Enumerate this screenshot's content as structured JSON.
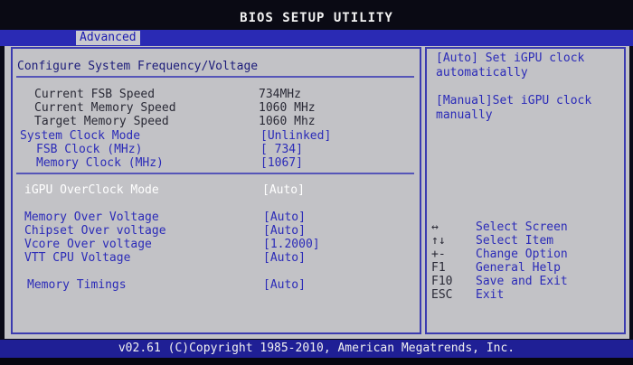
{
  "window": {
    "title": "BIOS SETUP UTILITY"
  },
  "tabs": [
    {
      "label": "Advanced",
      "active": true
    }
  ],
  "main": {
    "section_title": "Configure System Frequency/Voltage",
    "info_rows": [
      {
        "label": "Current FSB Speed",
        "value": "734MHz"
      },
      {
        "label": "Current Memory Speed",
        "value": "1060 MHz"
      },
      {
        "label": "Target Memory Speed",
        "value": "1060 Mhz"
      }
    ],
    "system_clock": [
      {
        "label": "System Clock Mode",
        "value": "[Unlinked]"
      },
      {
        "label": "FSB Clock (MHz)",
        "value": "[ 734]"
      },
      {
        "label": "Memory Clock (MHz)",
        "value": "[1067]"
      }
    ],
    "igpu": {
      "label": "iGPU OverClock Mode",
      "value": "[Auto]"
    },
    "voltages": [
      {
        "label": "Memory Over Voltage",
        "value": "[Auto]"
      },
      {
        "label": "Chipset Over voltage",
        "value": "[Auto]"
      },
      {
        "label": "Vcore Over voltage",
        "value": "[1.2000]"
      },
      {
        "label": "VTT CPU Voltage",
        "value": "[Auto]"
      }
    ],
    "timings": {
      "label": "Memory Timings",
      "value": "[Auto]"
    }
  },
  "help": {
    "auto_line1": "[Auto] Set iGPU clock",
    "auto_line2": "automatically",
    "manual_line1": "[Manual]Set iGPU clock",
    "manual_line2": "manually"
  },
  "keys": [
    {
      "key": "↔",
      "desc": "Select Screen"
    },
    {
      "key": "↑↓",
      "desc": "Select Item"
    },
    {
      "key": "+-",
      "desc": "Change Option"
    },
    {
      "key": "F1",
      "desc": "General Help"
    },
    {
      "key": "F10",
      "desc": "Save and Exit"
    },
    {
      "key": "ESC",
      "desc": "Exit"
    }
  ],
  "status": {
    "copyright": "v02.61 (C)Copyright 1985-2010, American Megatrends, Inc."
  },
  "colors": {
    "panel": "#c2c2c6",
    "highlight": "#2b2bb8",
    "bar": "#1f1f95",
    "dim": "#ffffff"
  }
}
